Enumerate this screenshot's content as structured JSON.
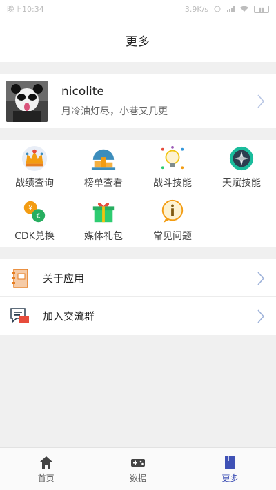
{
  "status_bar": {
    "time": "晚上10:34",
    "speed": "3.9K/s"
  },
  "header": {
    "title": "更多"
  },
  "profile": {
    "username": "nicolite",
    "signature": "月冷油灯尽，小巷又几更"
  },
  "grid": [
    {
      "label": "战绩查询",
      "icon": "crown-icon"
    },
    {
      "label": "榜单查看",
      "icon": "podium-icon"
    },
    {
      "label": "战斗技能",
      "icon": "lightbulb-icon"
    },
    {
      "label": "天赋技能",
      "icon": "compass-icon"
    },
    {
      "label": "CDK兑换",
      "icon": "exchange-icon"
    },
    {
      "label": "媒体礼包",
      "icon": "gift-icon"
    },
    {
      "label": "常见问题",
      "icon": "info-bubble-icon"
    }
  ],
  "menu": [
    {
      "label": "关于应用",
      "icon": "notebook-icon"
    },
    {
      "label": "加入交流群",
      "icon": "chat-icon"
    }
  ],
  "tabbar": [
    {
      "label": "首页",
      "icon": "home-icon"
    },
    {
      "label": "数据",
      "icon": "gamepad-icon"
    },
    {
      "label": "更多",
      "icon": "book-icon",
      "active": true
    }
  ],
  "colors": {
    "accent": "#3f51b5",
    "chevron": "#9fb3da"
  }
}
